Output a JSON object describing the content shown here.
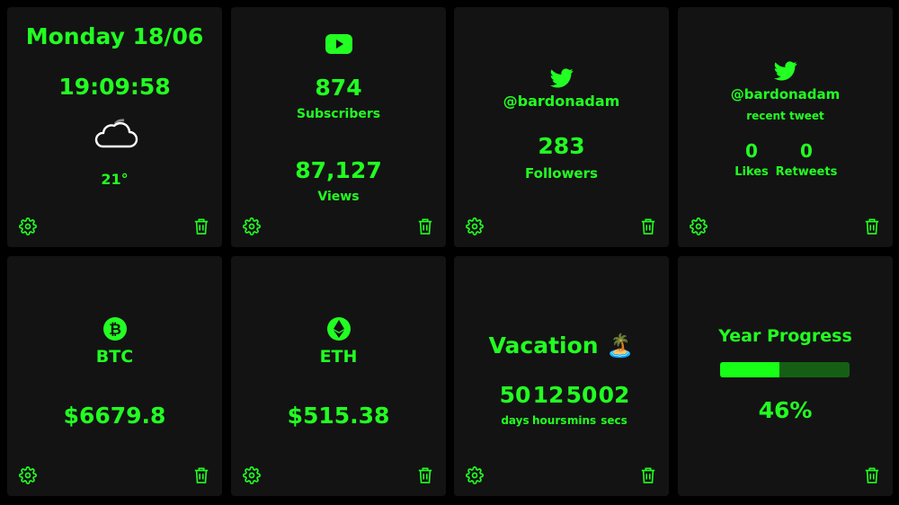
{
  "colors": {
    "accent": "#22ff22",
    "card_bg": "#131313",
    "page_bg": "#000000",
    "progress_track": "#155f15"
  },
  "cards": {
    "datetime": {
      "date": "Monday 18/06",
      "time": "19:09:58",
      "weather_icon": "cloud-icon",
      "temperature": "21°"
    },
    "youtube": {
      "icon": "youtube-icon",
      "subscribers": "874",
      "subscribers_label": "Subscribers",
      "views": "87,127",
      "views_label": "Views"
    },
    "twitter_followers": {
      "icon": "twitter-icon",
      "handle": "@bardonadam",
      "followers": "283",
      "followers_label": "Followers"
    },
    "twitter_tweet": {
      "icon": "twitter-icon",
      "handle": "@bardonadam",
      "subtitle": "recent tweet",
      "likes": "0",
      "likes_label": "Likes",
      "retweets": "0",
      "retweets_label": "Retweets"
    },
    "btc": {
      "icon": "bitcoin-icon",
      "name": "BTC",
      "price": "$6679.8"
    },
    "eth": {
      "icon": "ethereum-icon",
      "name": "ETH",
      "price": "$515.38"
    },
    "vacation": {
      "title": "Vacation 🏝️",
      "days": "50",
      "days_label": "days",
      "hours": "12",
      "hours_label": "hours",
      "mins": "50",
      "mins_label": "mins",
      "secs": "02",
      "secs_label": "secs"
    },
    "year_progress": {
      "title": "Year Progress",
      "percent": "46%",
      "progress_fraction": 0.46
    }
  }
}
